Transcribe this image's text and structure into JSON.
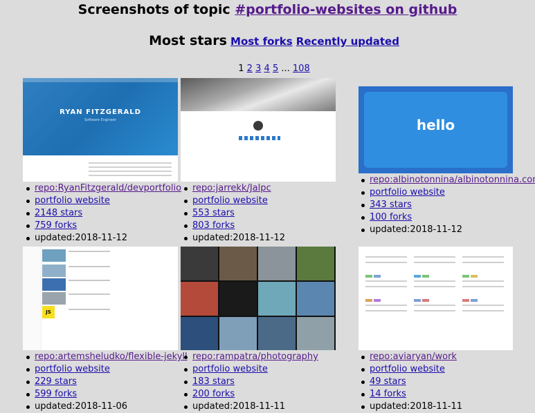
{
  "header": {
    "title_prefix": "Screenshots of topic ",
    "title_link": "#portfolio-websites on github"
  },
  "sort": {
    "current": "Most stars",
    "links": [
      "Most forks",
      "Recently updated"
    ]
  },
  "pager": {
    "current": "1",
    "pages": [
      "2",
      "3",
      "4",
      "5"
    ],
    "ellipsis": "...",
    "last": "108"
  },
  "thumb_text": {
    "t1_name": "RYAN FITZGERALD",
    "t1_sub": "Software Engineer",
    "t3_hello": "hello",
    "t4_js": "JS"
  },
  "cards": [
    {
      "repo": "repo:RyanFitzgerald/devportfolio",
      "topic": "portfolio website",
      "stars": "2148 stars",
      "forks": "759 forks",
      "updated": "updated:2018-11-12"
    },
    {
      "repo": "repo:jarrekk/Jalpc",
      "topic": "portfolio website",
      "stars": "553 stars",
      "forks": "803 forks",
      "updated": "updated:2018-11-12"
    },
    {
      "repo": "repo:albinotonnina/albinotonnina.com",
      "topic": "portfolio website",
      "stars": "343 stars",
      "forks": "100 forks",
      "updated": "updated:2018-11-12"
    },
    {
      "repo": "repo:artemsheludko/flexible-jekyll",
      "topic": "portfolio website",
      "stars": "229 stars",
      "forks": "599 forks",
      "updated": "updated:2018-11-06"
    },
    {
      "repo": "repo:rampatra/photography",
      "topic": "portfolio website",
      "stars": "183 stars",
      "forks": "200 forks",
      "updated": "updated:2018-11-11"
    },
    {
      "repo": "repo:aviaryan/work",
      "topic": "portfolio website",
      "stars": "49 stars",
      "forks": "14 forks",
      "updated": "updated:2018-11-11"
    }
  ]
}
